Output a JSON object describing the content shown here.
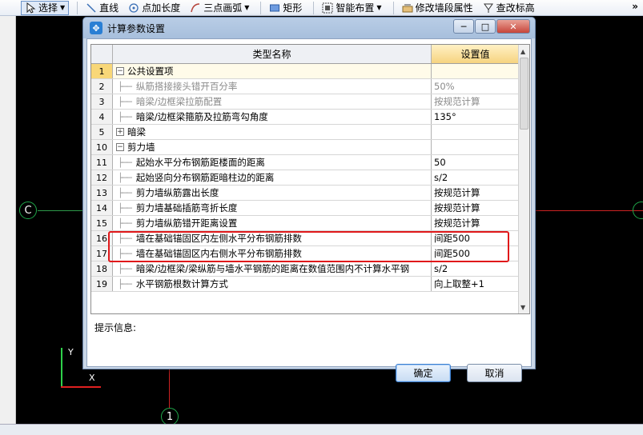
{
  "toolbar": {
    "select_label": "选择",
    "line_label": "直线",
    "point_length_label": "点加长度",
    "arc_label": "三点画弧",
    "rect_label": "矩形",
    "smart_layout_label": "智能布置",
    "modify_segment_label": "修改墙段属性",
    "check_elevation_label": "查改标高",
    "more_label": "»"
  },
  "canvas": {
    "axis_left_label": "C",
    "axis_bottom_label": "1",
    "y_label": "Y",
    "x_label": "X"
  },
  "dialog": {
    "title": "计算参数设置",
    "minimize_label": "─",
    "maximize_label": "□",
    "close_label": "✕",
    "col_name": "类型名称",
    "col_value": "设置值",
    "hint_label": "提示信息:",
    "ok_label": "确定",
    "cancel_label": "取消"
  },
  "rows": [
    {
      "num": "1",
      "name": "公共设置项",
      "value": "",
      "kind": "group",
      "expanded": true
    },
    {
      "num": "2",
      "name": "纵筋搭接接头错开百分率",
      "value": "50%",
      "kind": "dim"
    },
    {
      "num": "3",
      "name": "暗梁/边框梁拉筋配置",
      "value": "按规范计算",
      "kind": "dim"
    },
    {
      "num": "4",
      "name": "暗梁/边框梁箍筋及拉筋弯勾角度",
      "value": "135°",
      "kind": "item"
    },
    {
      "num": "5",
      "name": "暗梁",
      "value": "",
      "kind": "group",
      "expanded": false
    },
    {
      "num": "10",
      "name": "剪力墙",
      "value": "",
      "kind": "group",
      "expanded": true
    },
    {
      "num": "11",
      "name": "起始水平分布钢筋距楼面的距离",
      "value": "50",
      "kind": "item"
    },
    {
      "num": "12",
      "name": "起始竖向分布钢筋距暗柱边的距离",
      "value": "s/2",
      "kind": "item"
    },
    {
      "num": "13",
      "name": "剪力墙纵筋露出长度",
      "value": "按规范计算",
      "kind": "item"
    },
    {
      "num": "14",
      "name": "剪力墙基础插筋弯折长度",
      "value": "按规范计算",
      "kind": "item"
    },
    {
      "num": "15",
      "name": "剪力墙纵筋错开距离设置",
      "value": "按规范计算",
      "kind": "item"
    },
    {
      "num": "16",
      "name": "墙在基础锚固区内左侧水平分布钢筋排数",
      "value": "间距500",
      "kind": "item"
    },
    {
      "num": "17",
      "name": "墙在基础锚固区内右侧水平分布钢筋排数",
      "value": "间距500",
      "kind": "item"
    },
    {
      "num": "18",
      "name": "暗梁/边框梁/梁纵筋与墙水平钢筋的距离在数值范围内不计算水平钢",
      "value": "s/2",
      "kind": "item"
    },
    {
      "num": "19",
      "name": "水平钢筋根数计算方式",
      "value": "向上取整+1",
      "kind": "item"
    }
  ]
}
